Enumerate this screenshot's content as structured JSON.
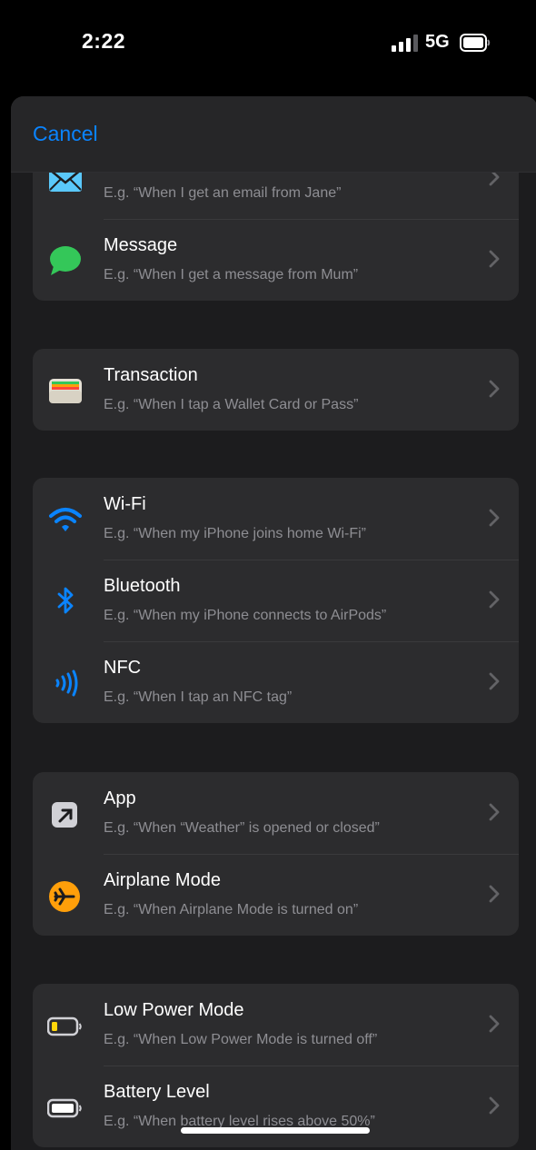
{
  "status_bar": {
    "time": "2:22",
    "network": "5G",
    "icons": [
      "signal-icon",
      "battery-icon"
    ]
  },
  "header": {
    "cancel_label": "Cancel"
  },
  "colors": {
    "accent": "#0a84ff",
    "message_green": "#34c759",
    "airplane_orange": "#ff9f0a",
    "low_power_yellow": "#ffd60a",
    "background": "#1c1c1e",
    "cell": "#2c2c2e"
  },
  "groups": [
    {
      "rows": [
        {
          "icon": "mail-icon",
          "title": "",
          "subtitle": "E.g. “When I get an email from Jane”"
        },
        {
          "icon": "message-icon",
          "title": "Message",
          "subtitle": "E.g. “When I get a message from Mum”"
        }
      ]
    },
    {
      "rows": [
        {
          "icon": "wallet-icon",
          "title": "Transaction",
          "subtitle": "E.g. “When I tap a Wallet Card or Pass”"
        }
      ]
    },
    {
      "rows": [
        {
          "icon": "wifi-icon",
          "title": "Wi-Fi",
          "subtitle": "E.g. “When my iPhone joins home Wi-Fi”"
        },
        {
          "icon": "bluetooth-icon",
          "title": "Bluetooth",
          "subtitle": "E.g. “When my iPhone connects to AirPods”"
        },
        {
          "icon": "nfc-icon",
          "title": "NFC",
          "subtitle": "E.g. “When I tap an NFC tag”"
        }
      ]
    },
    {
      "rows": [
        {
          "icon": "app-icon",
          "title": "App",
          "subtitle": "E.g. “When “Weather” is opened or closed”"
        },
        {
          "icon": "airplane-icon",
          "title": "Airplane Mode",
          "subtitle": "E.g. “When Airplane Mode is turned on”"
        }
      ]
    },
    {
      "rows": [
        {
          "icon": "low-battery-icon",
          "title": "Low Power Mode",
          "subtitle": "E.g. “When Low Power Mode is turned off”"
        },
        {
          "icon": "battery-level-icon",
          "title": "Battery Level",
          "subtitle": "E.g. “When battery level rises above 50%”"
        }
      ]
    }
  ]
}
